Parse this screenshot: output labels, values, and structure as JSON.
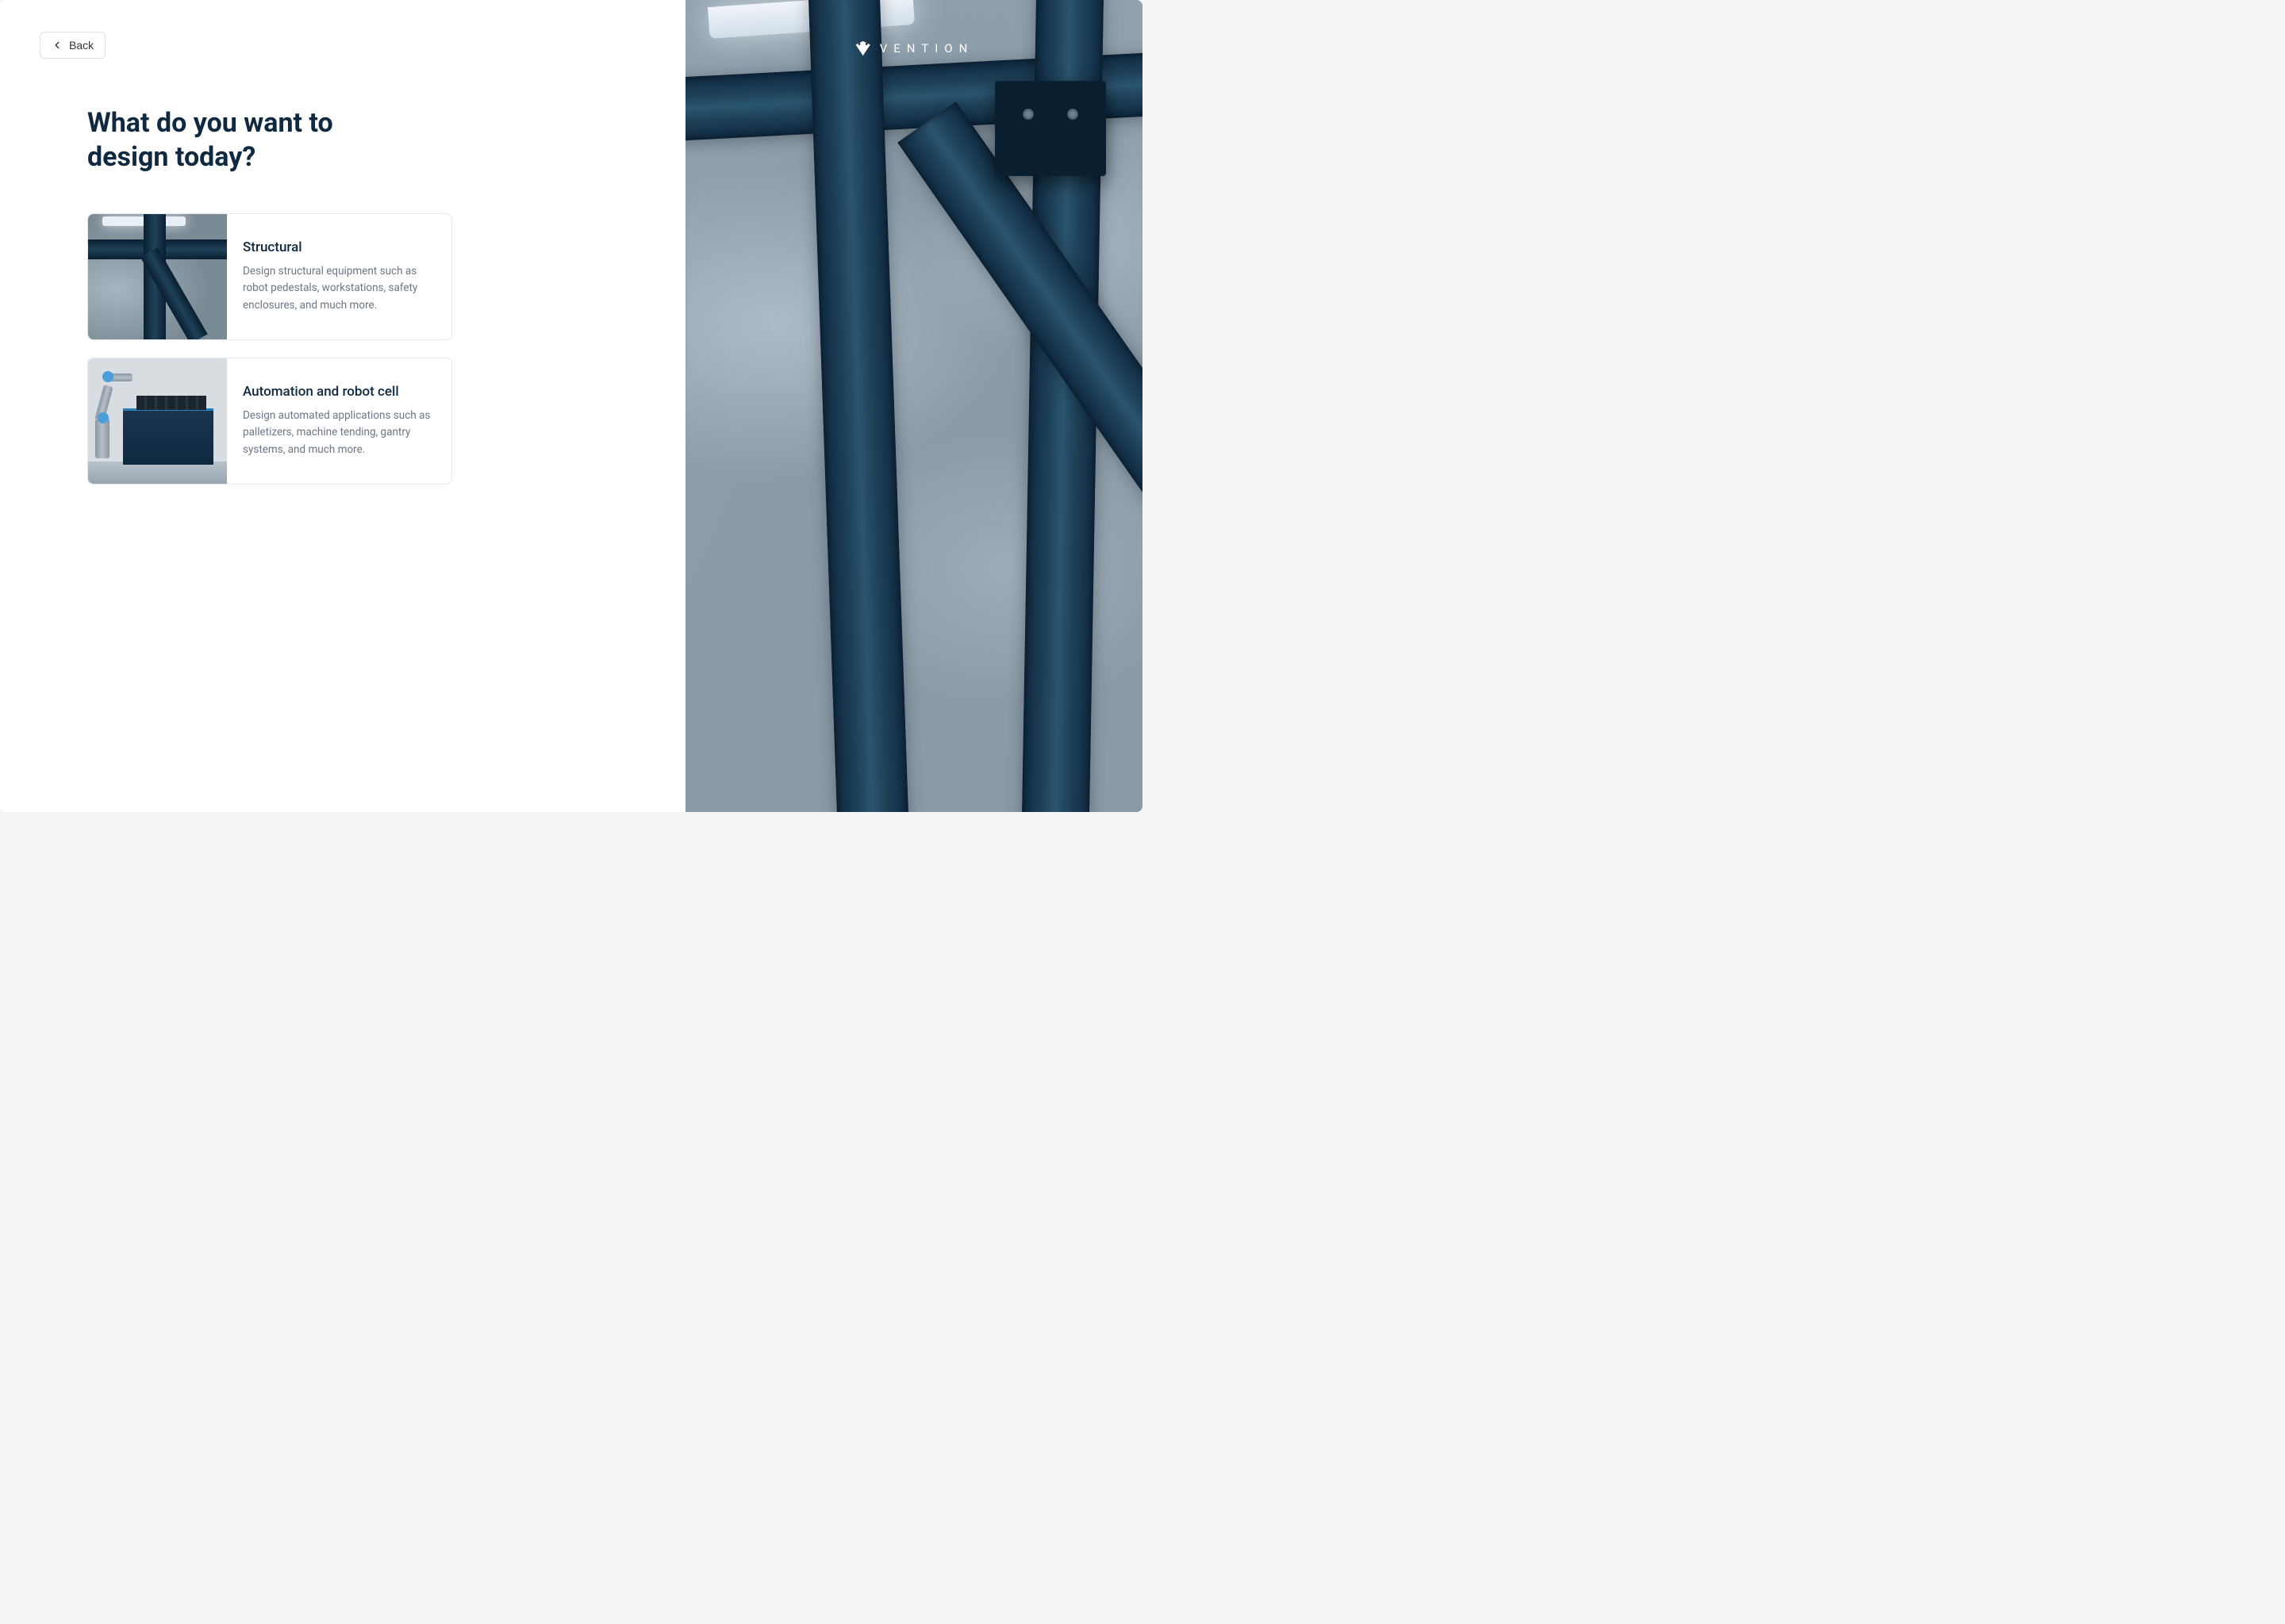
{
  "back_button": {
    "label": "Back"
  },
  "heading": "What do you want to design today?",
  "options": [
    {
      "title": "Structural",
      "description": "Design structural equipment such as robot pedestals, workstations, safety enclosures, and much more."
    },
    {
      "title": "Automation and robot cell",
      "description": "Design automated applications such as palletizers, machine tending, gantry systems, and much more."
    }
  ],
  "brand": {
    "name": "VENTION"
  }
}
